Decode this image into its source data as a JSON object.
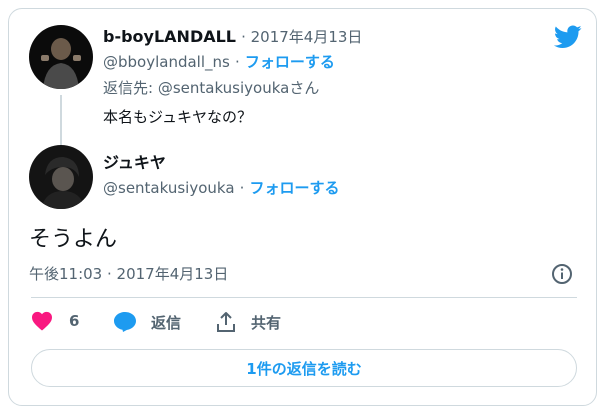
{
  "colors": {
    "accent": "#1d9bf0",
    "like": "#f91880",
    "muted": "#536471",
    "border": "#cfd9de"
  },
  "parent": {
    "display_name": "b-boyLANDALL",
    "date": "· 2017年4月13日",
    "handle": "@bboylandall_ns",
    "sep": "·",
    "follow_label": "フォローする",
    "reply_to_prefix": "返信先: ",
    "reply_to_handle": "@sentakusiyouka",
    "reply_to_suffix": "さん",
    "text": "本名もジュキヤなの？"
  },
  "reply": {
    "display_name": "ジュキヤ",
    "handle": "@sentakusiyouka",
    "sep": "·",
    "follow_label": "フォローする",
    "text": "そうよん",
    "timestamp": "午後11:03 · 2017年4月13日"
  },
  "actions": {
    "like_count": "6",
    "reply_label": "返信",
    "share_label": "共有"
  },
  "replies_button_label": "1件の返信を読む",
  "icons": [
    "twitter-bird-icon",
    "info-icon",
    "heart-icon",
    "reply-bubble-icon",
    "share-icon"
  ]
}
